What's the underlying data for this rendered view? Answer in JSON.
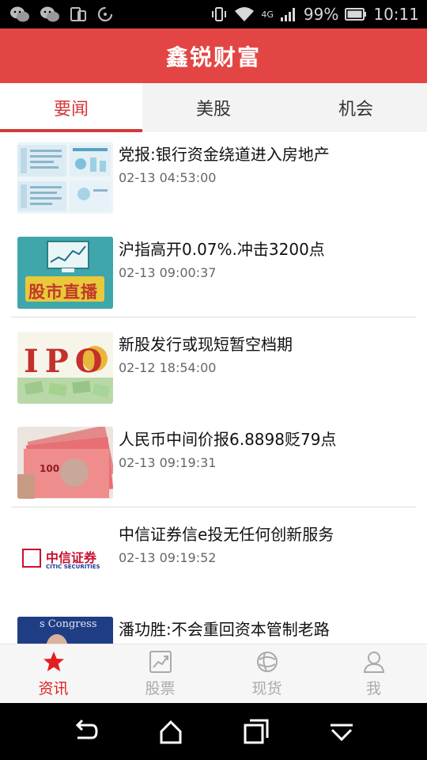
{
  "status_bar": {
    "battery_percent": "99%",
    "time": "10:11",
    "network": "4G"
  },
  "header": {
    "title": "鑫锐财富"
  },
  "tabs": [
    {
      "label": "要闻",
      "active": true
    },
    {
      "label": "美股",
      "active": false
    },
    {
      "label": "机会",
      "active": false
    }
  ],
  "news": [
    {
      "title": "党报:银行资金绕道进入房地产",
      "time": "02-13 04:53:00",
      "thumb": "infographic"
    },
    {
      "title": "沪指高开0.07%.冲击3200点",
      "time": "02-13 09:00:37",
      "thumb": "stock-live",
      "thumb_text": "股市直播"
    },
    {
      "title": "新股发行或现短暂空档期",
      "time": "02-12 18:54:00",
      "thumb": "ipo",
      "thumb_text": "IPO"
    },
    {
      "title": "人民币中间价报6.8898贬79点",
      "time": "02-13 09:19:31",
      "thumb": "rmb-banknotes",
      "thumb_text": "100"
    },
    {
      "title": "中信证券信e投无任何创新服务",
      "time": "02-13 09:19:52",
      "thumb": "citic-logo",
      "thumb_text_cn": "中信证券",
      "thumb_text_en": "CITIC SECURITIES"
    },
    {
      "title": "潘功胜:不会重回资本管制老路",
      "time": "",
      "thumb": "press-photo",
      "thumb_text": "s Congress"
    }
  ],
  "bottom_nav": [
    {
      "label": "资讯",
      "icon": "star-icon",
      "active": true
    },
    {
      "label": "股票",
      "icon": "stock-chart-icon",
      "active": false
    },
    {
      "label": "现货",
      "icon": "spot-goods-icon",
      "active": false
    },
    {
      "label": "我",
      "icon": "user-icon",
      "active": false
    }
  ],
  "colors": {
    "header_red": "#e34545",
    "accent_red": "#d33a3a",
    "nav_inactive": "#aaaaaa"
  }
}
